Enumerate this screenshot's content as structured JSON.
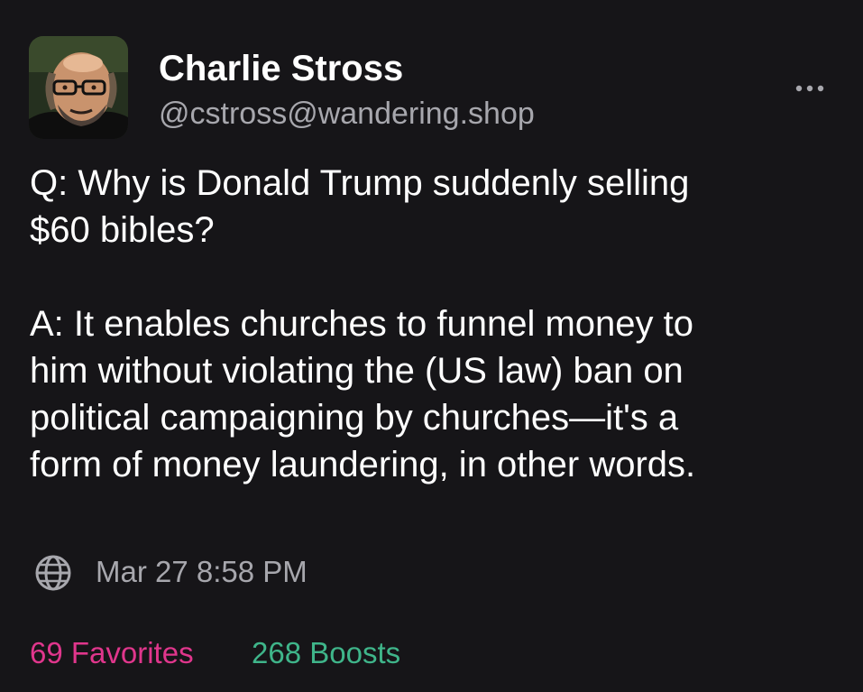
{
  "author": {
    "display_name": "Charlie Stross",
    "handle": "@cstross@wandering.shop"
  },
  "post": {
    "paragraphs": [
      "Q: Why is Donald Trump suddenly selling\n$60 bibles?",
      "A: It enables churches to funnel money to\nhim without violating the (US law) ban on\npolitical campaigning by churches—it's a\nform of money laundering, in other words."
    ],
    "visibility_icon": "globe-icon",
    "timestamp": "Mar 27 8:58 PM"
  },
  "stats": {
    "favorites_label": "69 Favorites",
    "boosts_label": "268 Boosts"
  },
  "menu": {
    "more_icon": "more-horizontal-icon"
  },
  "colors": {
    "background": "#161518",
    "text": "#ffffff",
    "muted": "#a7a7ad",
    "favorites": "#e0368c",
    "boosts": "#3fb58a"
  }
}
